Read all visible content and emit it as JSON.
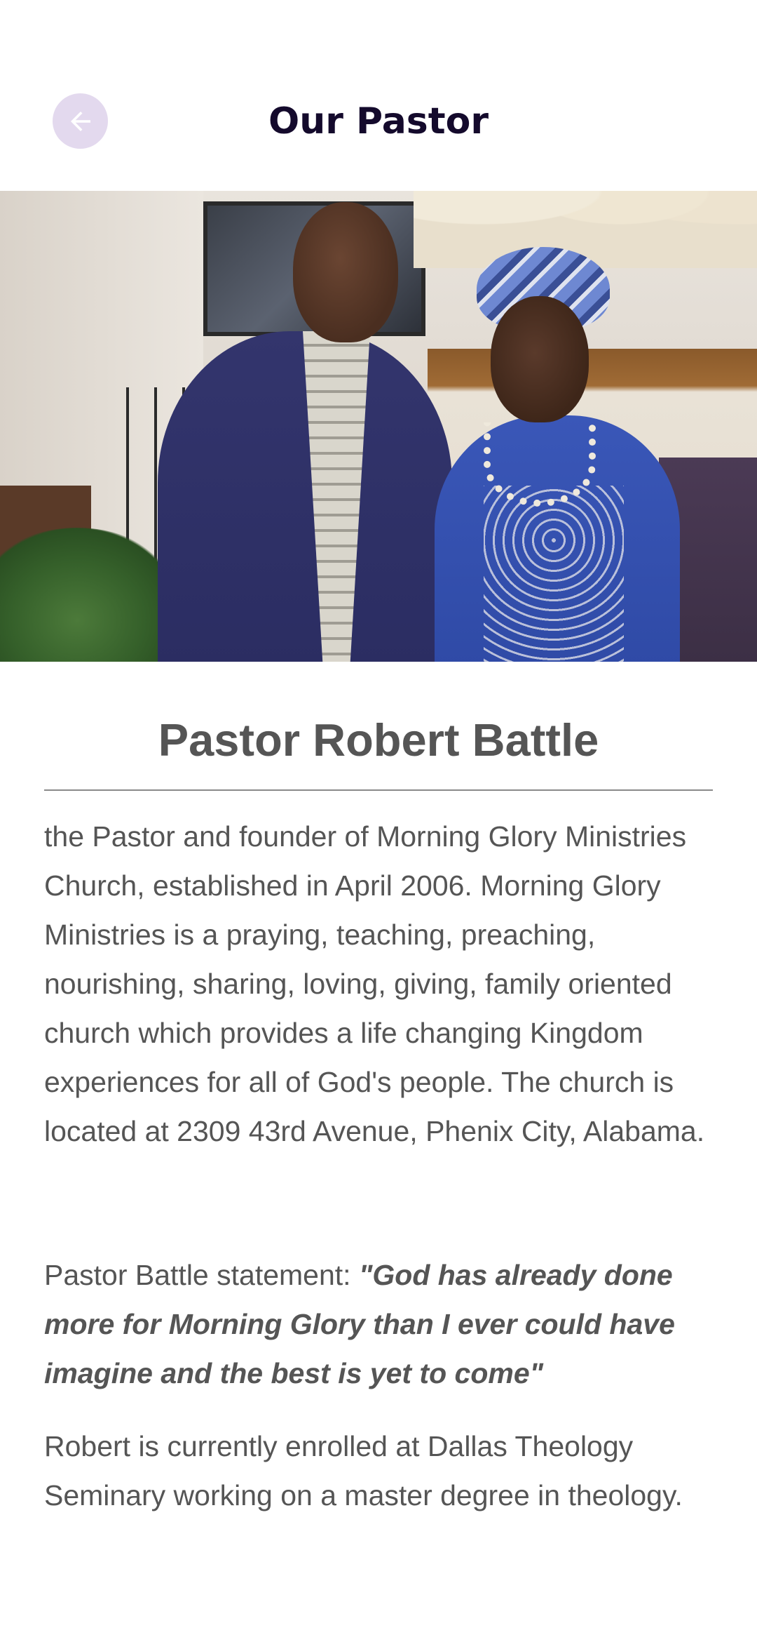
{
  "header": {
    "title": "Our Pastor",
    "back_icon": "arrow-left-icon",
    "back_button_color": "#e3d9ee",
    "title_color": "#140a2c"
  },
  "hero": {
    "alt": "Pastor Robert Battle and wife"
  },
  "profile": {
    "name": "Pastor Robert Battle",
    "bio": "the Pastor and founder of Morning Glory Ministries Church, established in April 2006. Morning Glory Ministries is a praying, teaching, preaching, nourishing, sharing, loving, giving, family oriented church which provides a life changing Kingdom experiences for all of God's people.  The church is located at 2309 43rd Avenue, Phenix City, Alabama.",
    "statement_prefix": "Pastor Battle statement: ",
    "statement_quote": "\"God has already done more for Morning Glory than I ever could have imagine and the best is yet to come\"",
    "enrollment": "Robert is currently enrolled at Dallas Theology Seminary working on a master degree in theology."
  },
  "colors": {
    "text": "#555555",
    "divider": "#8a8a8a"
  }
}
